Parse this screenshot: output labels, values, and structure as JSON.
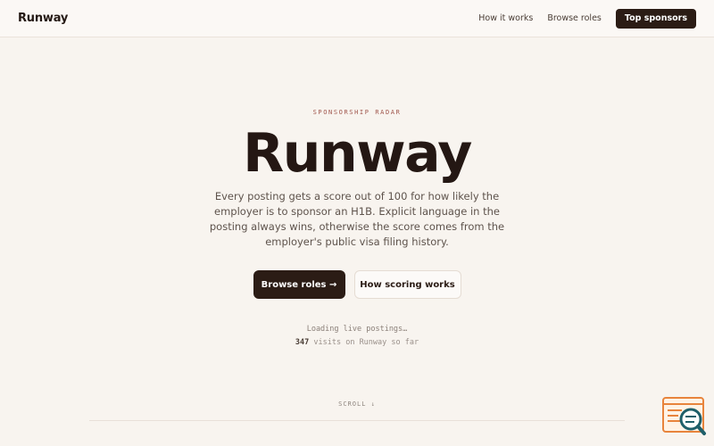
{
  "header": {
    "brand": "Runway",
    "nav": [
      {
        "label": "How it works"
      },
      {
        "label": "Browse roles"
      }
    ],
    "cta_label": "Top sponsors"
  },
  "hero": {
    "eyebrow": "SPONSORSHIP RADAR",
    "title": "Runway",
    "description": "Every posting gets a score out of 100 for how likely the employer is to sponsor an H1B. Explicit language in the posting always wins, otherwise the score comes from the employer's public visa filing history.",
    "primary_button": "Browse roles →",
    "secondary_button": "How scoring works",
    "status": "Loading live postings…",
    "visits_count": "347",
    "visits_suffix": "visits on Runway so far",
    "scroll_label": "SCROLL ↓"
  },
  "colors": {
    "background": "#f8f4ef",
    "dark": "#2b1c15",
    "eyebrow": "#a0564c",
    "widget_accent": "#e8843c",
    "widget_teal": "#1f5f6a"
  },
  "icons": {
    "widget": "search-chat-icon"
  }
}
